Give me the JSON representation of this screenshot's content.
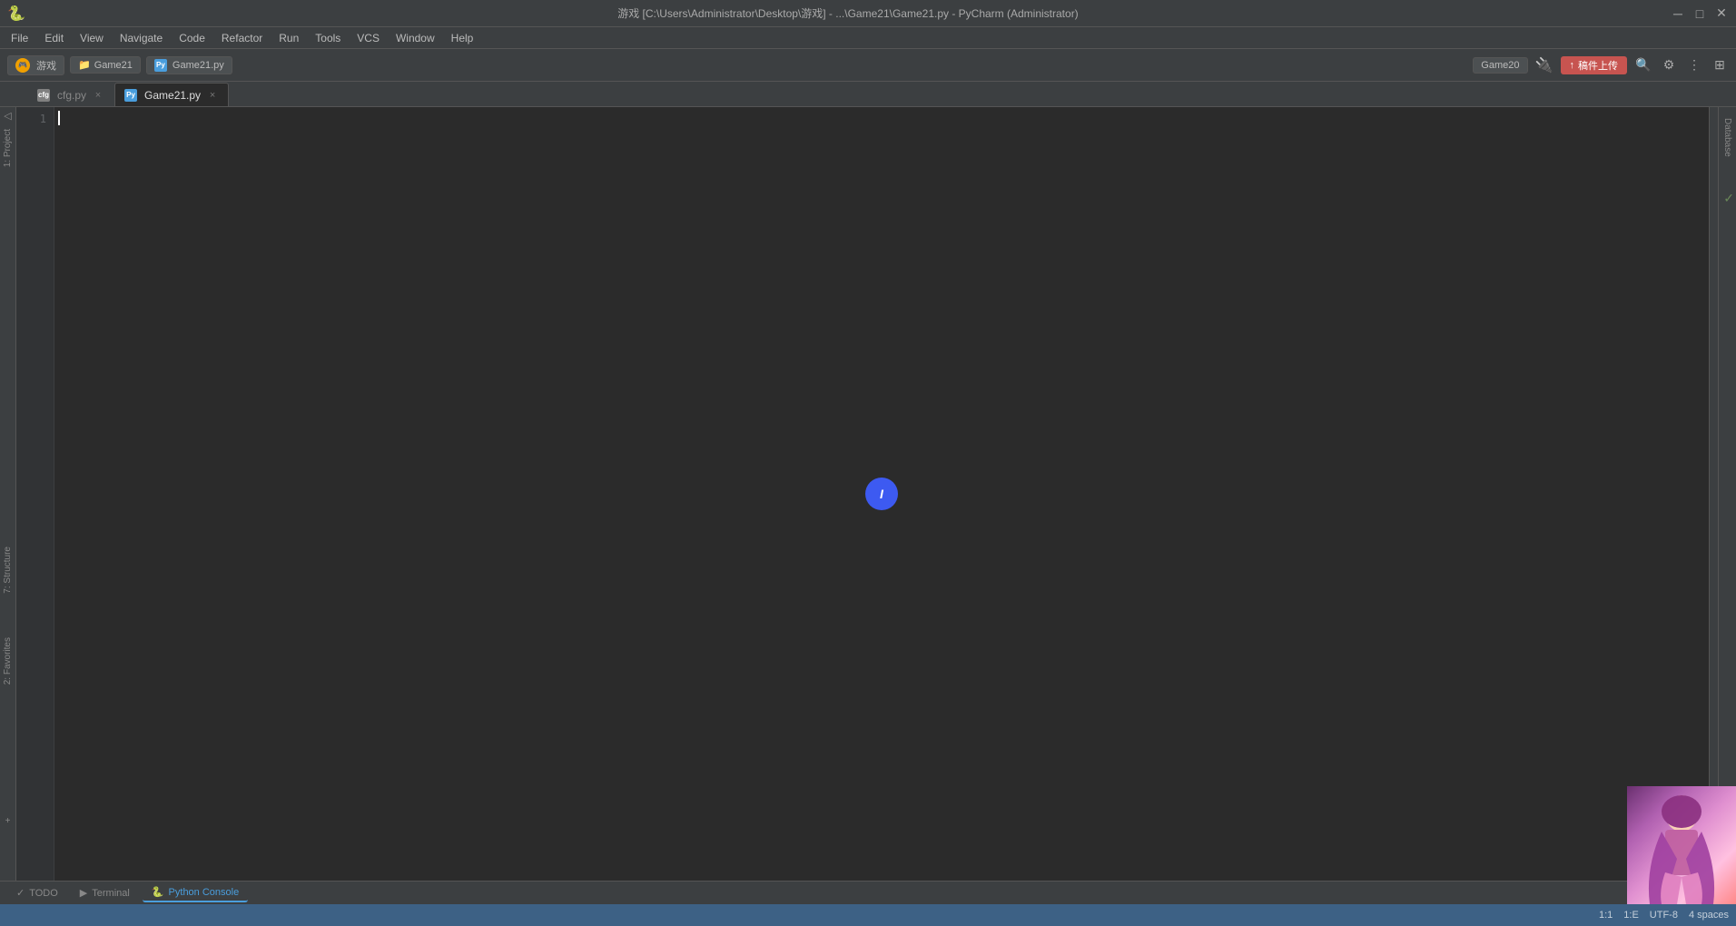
{
  "titleBar": {
    "title": "游戏 [C:\\Users\\Administrator\\Desktop\\游戏] - ...\\Game21\\Game21.py - PyCharm (Administrator)",
    "windowControls": {
      "minimize": "─",
      "maximize": "□",
      "close": "✕"
    }
  },
  "menuBar": {
    "items": [
      "File",
      "Edit",
      "View",
      "Navigate",
      "Code",
      "Refactor",
      "Run",
      "Tools",
      "VCS",
      "Window",
      "Help"
    ]
  },
  "toolbar": {
    "projectName": "游戏",
    "folderName": "Game21",
    "fileName": "Game21.py",
    "recentProject": "Game20",
    "uploadLabel": "稿件上传",
    "searchIcon": "🔍",
    "settingsIcon": "⚙"
  },
  "fileTabs": {
    "tabs": [
      {
        "label": "cfg.py",
        "type": "cfg",
        "active": false
      },
      {
        "label": "Game21.py",
        "type": "py",
        "active": true
      }
    ]
  },
  "editor": {
    "content": "",
    "cursorPosition": "1:1",
    "lineCount": 1,
    "blueDot": {
      "visible": true,
      "label": "I"
    }
  },
  "sidebarLeft": {
    "projectLabel": "1: Project",
    "structureLabel": "7: Structure",
    "favoritesLabel": "2: Favorites"
  },
  "sidebarRight": {
    "databaseLabel": "Database"
  },
  "bottomTabs": {
    "tabs": [
      {
        "label": "TODO",
        "icon": "✓",
        "active": false
      },
      {
        "label": "Terminal",
        "icon": "▶",
        "active": false
      },
      {
        "label": "Python Console",
        "icon": "🐍",
        "active": true
      }
    ]
  },
  "statusBar": {
    "cursorPos": "1:1",
    "lineInfo": "1:E",
    "encoding": "UTF-8",
    "lineEnding": "4 spaces",
    "checkmark": "✓"
  },
  "icons": {
    "minimize": "─",
    "maximize": "□",
    "close": "✕",
    "search": "🔍",
    "gear": "⚙",
    "project": "📁",
    "file": "📄",
    "add": "+",
    "python": "Py",
    "terminal": ">_",
    "todo": "✓",
    "console": ">>",
    "chevronDown": "▼",
    "chevronRight": "▶"
  },
  "colors": {
    "bg": "#2b2b2b",
    "toolbar": "#3c3f41",
    "accent": "#4a9edd",
    "statusBar": "#3d6185",
    "blueDot": "#3d5af1",
    "upload": "#c75450"
  }
}
